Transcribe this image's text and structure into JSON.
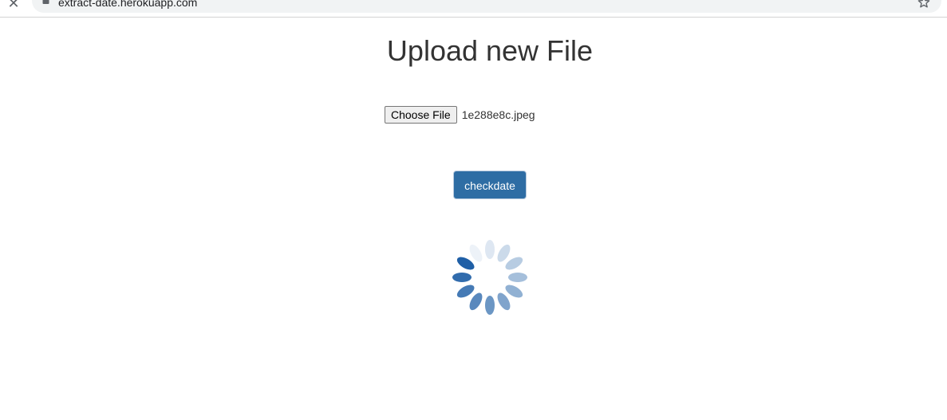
{
  "browser": {
    "url": "extract-date.herokuapp.com",
    "close_icon": "close-icon",
    "lock_icon": "lock-icon",
    "star_icon": "star-icon"
  },
  "page": {
    "title": "Upload new File",
    "choose_file_label": "Choose File",
    "selected_file": "1e288e8c.jpeg",
    "submit_label": "checkdate",
    "loading_icon": "loading-spinner-icon"
  },
  "colors": {
    "button_bg": "#2e6da4",
    "spinner": "#1f5fa6",
    "text": "#333333"
  }
}
